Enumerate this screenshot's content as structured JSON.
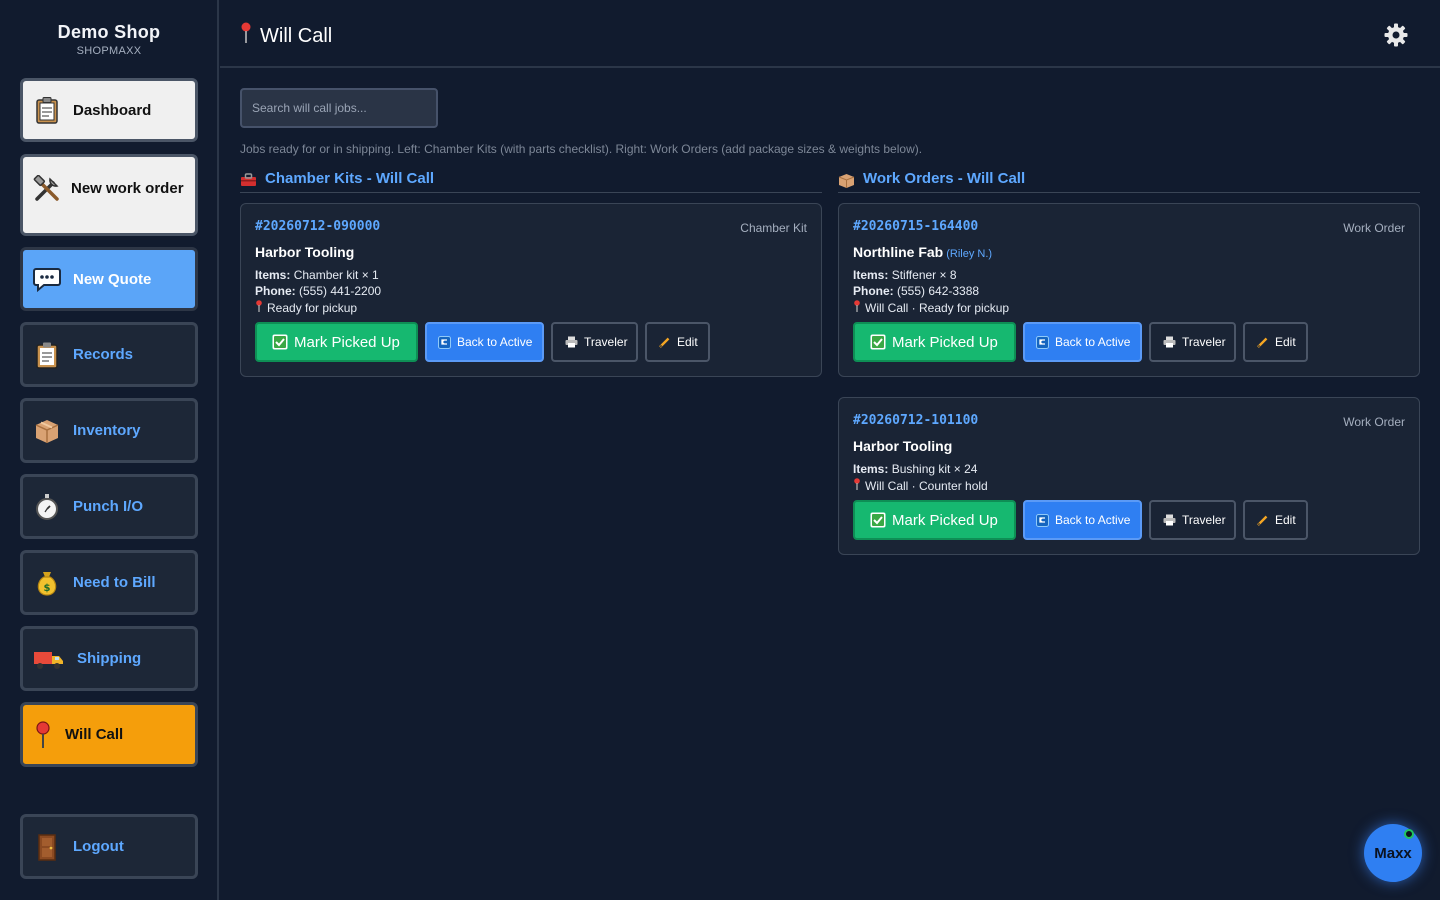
{
  "brand": {
    "name": "Demo Shop",
    "sub": "SHOPMAXX"
  },
  "nav": {
    "dashboard": "Dashboard",
    "new_work_order": "New work order",
    "new_quote": "New Quote",
    "records": "Records",
    "inventory": "Inventory",
    "punch": "Punch I/O",
    "need_to_bill": "Need to Bill",
    "shipping": "Shipping",
    "will_call": "Will Call",
    "logout": "Logout"
  },
  "header": {
    "title": "Will Call"
  },
  "search": {
    "placeholder": "Search will call jobs..."
  },
  "hint": "Jobs ready for or in shipping. Left: Chamber Kits (with parts checklist). Right: Work Orders (add package sizes & weights below).",
  "columns": {
    "chamber": "Chamber Kits - Will Call",
    "work_orders": "Work Orders - Will Call"
  },
  "labels": {
    "items": "Items:",
    "phone": "Phone:",
    "mark_picked_up": "Mark Picked Up",
    "back_to_active": "Back to Active",
    "traveler": "Traveler",
    "edit": "Edit"
  },
  "cards": [
    {
      "job": "#20260712-090000",
      "type": "Chamber Kit",
      "customer": "Harbor Tooling",
      "contact": "",
      "items": "Chamber kit × 1",
      "phone": "(555) 441-2200",
      "status": "Ready for pickup"
    },
    {
      "job": "#20260715-164400",
      "type": "Work Order",
      "customer": "Northline Fab",
      "contact": "(Riley N.)",
      "items": "Stiffener × 8",
      "phone": "(555) 642-3388",
      "status": "Will Call · Ready for pickup"
    },
    {
      "job": "#20260712-101100",
      "type": "Work Order",
      "customer": "Harbor Tooling",
      "contact": "",
      "items": "Bushing kit × 24",
      "phone": "",
      "status": "Will Call · Counter hold"
    }
  ],
  "assistant": {
    "label": "Maxx"
  },
  "colors": {
    "background": "#111b2e",
    "accent_blue": "#5ea8ff",
    "active_nav": "#f59e0b",
    "success_green": "#16b870",
    "button_blue": "#2f7ff2"
  },
  "icons": {
    "dashboard": "clipboard-icon",
    "new_work_order": "tools-icon",
    "new_quote": "speech-bubble-icon",
    "records": "clipboard-icon",
    "inventory": "package-icon",
    "punch": "stopwatch-icon",
    "need_to_bill": "money-bag-icon",
    "shipping": "truck-icon",
    "will_call": "pushpin-icon",
    "logout": "door-icon",
    "settings": "gear-icon"
  }
}
